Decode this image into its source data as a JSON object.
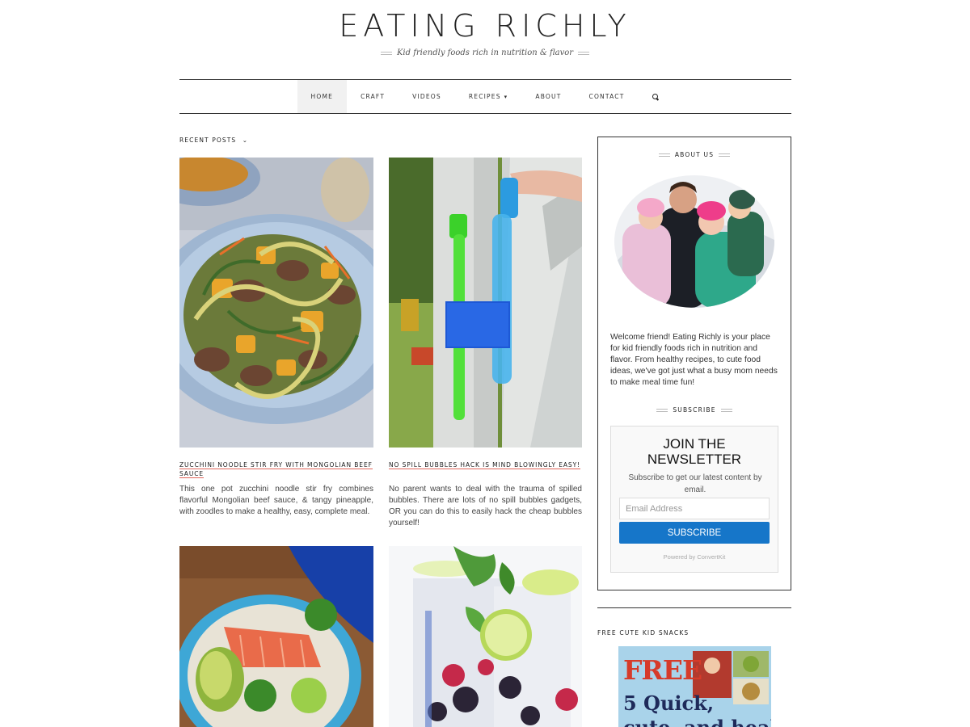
{
  "header": {
    "site_title": "EATING RICHLY",
    "tagline": "Kid friendly foods rich in nutrition & flavor"
  },
  "nav": {
    "items": [
      {
        "label": "HOME",
        "active": true
      },
      {
        "label": "CRAFT"
      },
      {
        "label": "VIDEOS"
      },
      {
        "label": "RECIPES",
        "dropdown": true
      },
      {
        "label": "ABOUT"
      },
      {
        "label": "CONTACT"
      }
    ],
    "search_icon": "search-icon"
  },
  "recent_posts": {
    "label": "RECENT POSTS",
    "posts": [
      {
        "title": "ZUCCHINI NOODLE STIR FRY WITH MONGOLIAN BEEF SAUCE",
        "excerpt": "This one pot zucchini noodle stir fry combines flavorful Mongolian beef sauce, & tangy pineapple, with zoodles to make a healthy, easy, complete meal."
      },
      {
        "title": "NO SPILL BUBBLES HACK IS MIND BLOWINGLY EASY!",
        "excerpt": "No parent wants to deal with the trauma of spilled bubbles. There are lots of no spill bubbles gadgets, OR you can do this to easily hack the cheap bubbles yourself!"
      }
    ]
  },
  "sidebar": {
    "about_title": "ABOUT US",
    "about_text": "Welcome friend! Eating Richly is your place for kid friendly foods rich in nutrition and flavor. From healthy recipes, to cute food ideas, we've got just what a busy mom needs to make meal time fun!",
    "subscribe_title": "SUBSCRIBE",
    "newsletter": {
      "heading_line1": "JOIN THE",
      "heading_line2": "NEWSLETTER",
      "description": "Subscribe to get our latest content by email.",
      "email_placeholder": "Email Address",
      "button_label": "SUBSCRIBE",
      "powered_by": "Powered by ConvertKit"
    },
    "snacks_label": "FREE CUTE KID SNACKS",
    "ad": {
      "line1": "FREE",
      "line2": "5 Quick,",
      "line3": "cute, and healthy"
    }
  },
  "colors": {
    "accent_underline": "#e0645a",
    "subscribe_button": "#1676c9"
  }
}
